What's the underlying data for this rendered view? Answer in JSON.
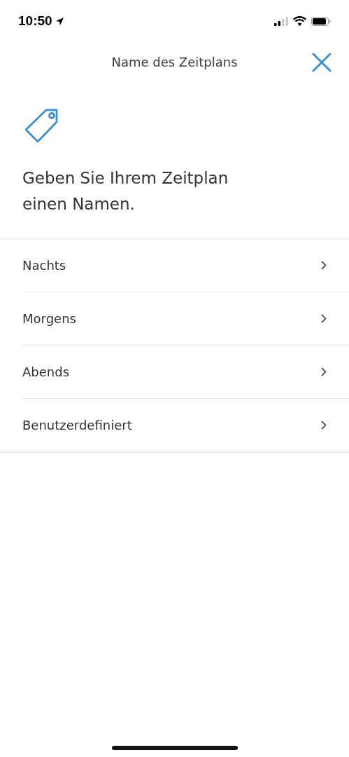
{
  "status_bar": {
    "time": "10:50"
  },
  "header": {
    "title": "Name des Zeitplans"
  },
  "prompt": "Geben Sie Ihrem Zeitplan einen Namen.",
  "options": [
    {
      "label": "Nachts"
    },
    {
      "label": "Morgens"
    },
    {
      "label": "Abends"
    },
    {
      "label": "Benutzerdefiniert"
    }
  ]
}
